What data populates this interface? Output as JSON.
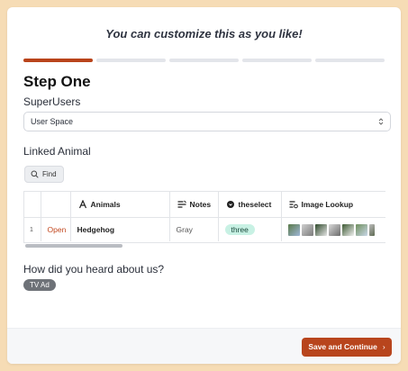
{
  "form": {
    "header_title": "You can customize this as you like!",
    "progress": {
      "total_steps": 5,
      "current_step": 1
    },
    "step_title": "Step One",
    "superusers": {
      "label": "SuperUsers",
      "selected": "User Space"
    },
    "linked_animal": {
      "label": "Linked Animal",
      "find_label": "Find",
      "columns": [
        {
          "label": "Animals",
          "icon": "text-a-icon"
        },
        {
          "label": "Notes",
          "icon": "notes-lines-icon"
        },
        {
          "label": "theselect",
          "icon": "select-dot-icon"
        },
        {
          "label": "Image Lookup",
          "icon": "lookup-lines-icon"
        }
      ],
      "rows": [
        {
          "number": "1",
          "open_label": "Open",
          "animal": "Hedgehog",
          "notes": "Gray",
          "select": "three"
        }
      ]
    },
    "heard": {
      "label": "How did you heard about us?",
      "selected_tag": "TV Ad"
    },
    "footer": {
      "save_label": "Save and Continue"
    }
  },
  "colors": {
    "page_background": "#f6dcb5",
    "accent": "#b8451d",
    "pill_background": "#c8f1e4",
    "tag_background": "#6e7278"
  }
}
